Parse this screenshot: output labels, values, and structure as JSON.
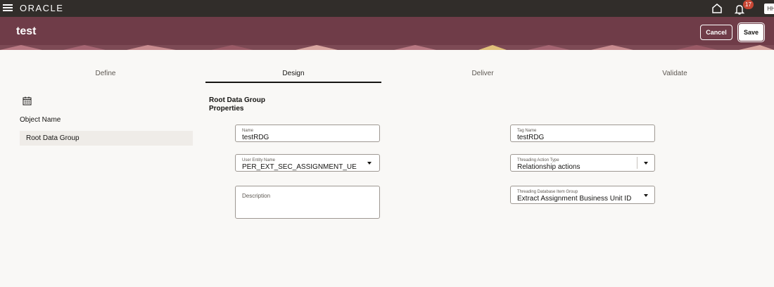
{
  "topbar": {
    "logo": "ORACLE",
    "notification_count": "17",
    "avatar_initials": "HH"
  },
  "header": {
    "title": "test",
    "cancel_label": "Cancel",
    "save_label": "Save",
    "colors": {
      "header_bg": "#6f3c48",
      "topbar_bg": "#312d2a",
      "badge": "#c74634"
    }
  },
  "tabs": [
    {
      "label": "Define",
      "active": false
    },
    {
      "label": "Design",
      "active": true
    },
    {
      "label": "Deliver",
      "active": false
    },
    {
      "label": "Validate",
      "active": false
    }
  ],
  "sidebar": {
    "icon": "calendar-icon",
    "label": "Object Name",
    "items": [
      {
        "label": "Root Data Group"
      }
    ]
  },
  "form": {
    "section_title_line1": "Root Data Group",
    "section_title_line2": "Properties",
    "name": {
      "label": "Name",
      "value": "testRDG"
    },
    "tag_name": {
      "label": "Tag Name",
      "value": "testRDG"
    },
    "user_entity_name": {
      "label": "User Entity Name",
      "value": "PER_EXT_SEC_ASSIGNMENT_UE"
    },
    "threading_action_type": {
      "label": "Threading Action Type",
      "value": "Relationship actions"
    },
    "description": {
      "label": "Description",
      "value": ""
    },
    "threading_db_item_group": {
      "label": "Threading Database Item Group",
      "value": "Extract Assignment Business Unit ID"
    }
  }
}
